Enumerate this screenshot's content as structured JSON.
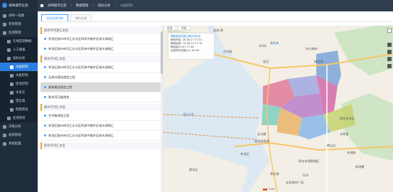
{
  "brand": {
    "title": "海绵城市信息"
  },
  "sidebar": {
    "items": [
      {
        "label": "海绵一张图"
      },
      {
        "label": "项目管理"
      },
      {
        "label": "监测管理"
      },
      {
        "label": "在线监测数据"
      },
      {
        "label": "人工填报"
      },
      {
        "label": "指标分析"
      },
      {
        "label": "水面控制"
      },
      {
        "label": "水质控制"
      },
      {
        "label": "径流控制"
      },
      {
        "label": "水安全"
      },
      {
        "label": "望云城"
      },
      {
        "label": "制度建设"
      },
      {
        "label": "监测系统"
      },
      {
        "label": "决策分析"
      },
      {
        "label": "权限管理"
      },
      {
        "label": "系统配置"
      }
    ]
  },
  "topbar": {
    "items": [
      "海绵城市信息",
      "数据管理",
      "指标分析",
      "水面控制"
    ]
  },
  "tabs": [
    {
      "label": "径流总量控制"
    },
    {
      "label": "城市水域"
    }
  ],
  "list": {
    "groups": [
      {
        "title": "胶州市河道汇水区",
        "rows": [
          "李沧区胶州市河汇水分区四流中路片区街头绿地汇",
          "李沧区胶州市河汇水分区四流中路片区街头绿地汇"
        ]
      },
      {
        "title": "胶州市河汇水区",
        "rows": [
          "李沧区胶州市河汇水分区四流中路片区街头绿地汇",
          "石岗口建设改造工程",
          "湘和建设改造工程",
          "胶州湾河道改造"
        ]
      },
      {
        "title": "胶州市河汇水区",
        "rows": [
          "大中路改造工程",
          "李沧区胶州市河汇水分区四流中路片区街头绿地汇",
          "李沧区胶州市河汇水分区四流中路片区街头绿地汇"
        ]
      },
      {
        "title": "胶州市河汇水区",
        "rows": []
      }
    ]
  },
  "map": {
    "tabs": [
      "径流",
      "列表"
    ],
    "info": {
      "title": "湘和建设改造工程(年径流)",
      "line1": "降雨开始: 16-08-17 07:03",
      "line2": "降雨结束: 16-08-15 07:18",
      "line3": "降雨量(mm): 27.80",
      "line4": "控制率实测值(%): 80.69"
    },
    "labels": {
      "sea": "胶州湾",
      "l1": "龙游·港",
      "l2": "大学路",
      "l3": "青岛市",
      "l4": "北区",
      "l5": "东方城市",
      "l6": "城阳湖",
      "l7": "金水路",
      "l8": "青岛保税港",
      "l9": "李沧区",
      "l10": "青岛市保税港区",
      "l11": "丰和里",
      "l12": "崂山区",
      "l13": "东海路",
      "l14": "青岛市北区",
      "l15": "黄岛区",
      "l16": "青岛港",
      "l17": "新湖景",
      "l18": "宝龙城市广场",
      "l19": "S218",
      "l20": "G22"
    },
    "scale_label": "5 km"
  }
}
